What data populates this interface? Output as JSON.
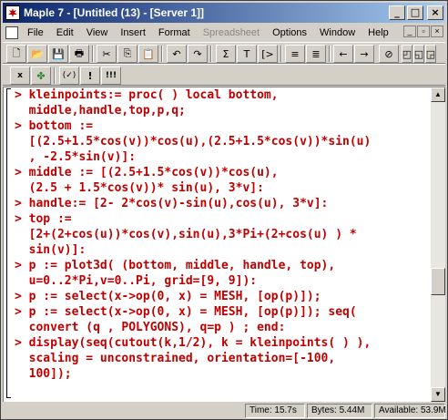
{
  "window": {
    "title": "Maple 7 - [Untitled (13) - [Server 1]]",
    "buttons": [
      "_",
      "□",
      "×"
    ]
  },
  "menu": {
    "items": [
      {
        "label": "File",
        "disabled": false
      },
      {
        "label": "Edit",
        "disabled": false
      },
      {
        "label": "View",
        "disabled": false
      },
      {
        "label": "Insert",
        "disabled": false
      },
      {
        "label": "Format",
        "disabled": false
      },
      {
        "label": "Spreadsheet",
        "disabled": true
      },
      {
        "label": "Options",
        "disabled": false
      },
      {
        "label": "Window",
        "disabled": false
      },
      {
        "label": "Help",
        "disabled": false
      }
    ],
    "doc_buttons": [
      "_",
      "▫",
      "×"
    ]
  },
  "toolbar1": {
    "buttons": [
      {
        "name": "new-document",
        "glyph": "🗋"
      },
      {
        "name": "open",
        "glyph": "📂"
      },
      {
        "name": "save",
        "glyph": "💾"
      },
      {
        "name": "print",
        "glyph": "🖶"
      },
      {
        "name": "cut",
        "glyph": "✂"
      },
      {
        "name": "copy",
        "glyph": "⎘"
      },
      {
        "name": "paste",
        "glyph": "📋"
      },
      {
        "name": "undo",
        "glyph": "↶"
      },
      {
        "name": "redo",
        "glyph": "↷"
      },
      {
        "name": "sigma",
        "glyph": "Σ"
      },
      {
        "name": "text",
        "glyph": "T"
      },
      {
        "name": "prompt",
        "glyph": "[>"
      },
      {
        "name": "indent",
        "glyph": "≡"
      },
      {
        "name": "outdent",
        "glyph": "≣"
      },
      {
        "name": "back",
        "glyph": "←"
      },
      {
        "name": "forward",
        "glyph": "→"
      },
      {
        "name": "stop",
        "glyph": "⊘"
      },
      {
        "name": "zoom-1",
        "glyph": "◰"
      },
      {
        "name": "zoom-2",
        "glyph": "◱"
      },
      {
        "name": "zoom-3",
        "glyph": "◲"
      },
      {
        "name": "zoom-4",
        "glyph": "⊞"
      }
    ]
  },
  "toolbar2": {
    "buttons": [
      {
        "name": "maple-notation",
        "glyph": "x"
      },
      {
        "name": "maple-leaf",
        "glyph": "✤"
      },
      {
        "name": "inert",
        "glyph": "(✓)"
      },
      {
        "name": "execute",
        "glyph": "!"
      },
      {
        "name": "execute-all",
        "glyph": "!!!"
      }
    ]
  },
  "worksheet": {
    "lines": [
      {
        "prompt": ">",
        "text": "kleinpoints:= proc( ) local bottom,"
      },
      {
        "prompt": "",
        "text": "middle,handle,top,p,q;"
      },
      {
        "prompt": ">",
        "text": "bottom :="
      },
      {
        "prompt": "",
        "text": "[(2.5+1.5*cos(v))*cos(u),(2.5+1.5*cos(v))*sin(u)"
      },
      {
        "prompt": "",
        "text": ", -2.5*sin(v)]:"
      },
      {
        "prompt": ">",
        "text": "middle := [(2.5+1.5*cos(v))*cos(u),"
      },
      {
        "prompt": "",
        "text": "(2.5 + 1.5*cos(v))* sin(u), 3*v]:"
      },
      {
        "prompt": ">",
        "text": "handle:= [2- 2*cos(v)-sin(u),cos(u), 3*v]:"
      },
      {
        "prompt": ">",
        "text": "top :="
      },
      {
        "prompt": "",
        "text": "[2+(2+cos(u))*cos(v),sin(u),3*Pi+(2+cos(u) ) *"
      },
      {
        "prompt": "",
        "text": "sin(v)]:"
      },
      {
        "prompt": ">",
        "text": "p := plot3d( (bottom, middle, handle, top),"
      },
      {
        "prompt": "",
        "text": "u=0..2*Pi,v=0..Pi, grid=[9, 9]):"
      },
      {
        "prompt": ">",
        "text": "p := select(x->op(0, x) = MESH, [op(p)]);"
      },
      {
        "prompt": ">",
        "text": "p := select(x->op(0, x) = MESH, [op(p)]); seq("
      },
      {
        "prompt": "",
        "text": "convert (q , POLYGONS), q=p ) ; end:"
      },
      {
        "prompt": ">",
        "text": "display(seq(cutout(k,1/2), k = kleinpoints( ) ),"
      },
      {
        "prompt": "",
        "text": "scaling = unconstrained, orientation=[-100,"
      },
      {
        "prompt": "",
        "text": "100]);"
      }
    ]
  },
  "status": {
    "time": "Time: 15.7s",
    "bytes": "Bytes: 5.44M",
    "available": "Available: 53.9M"
  }
}
